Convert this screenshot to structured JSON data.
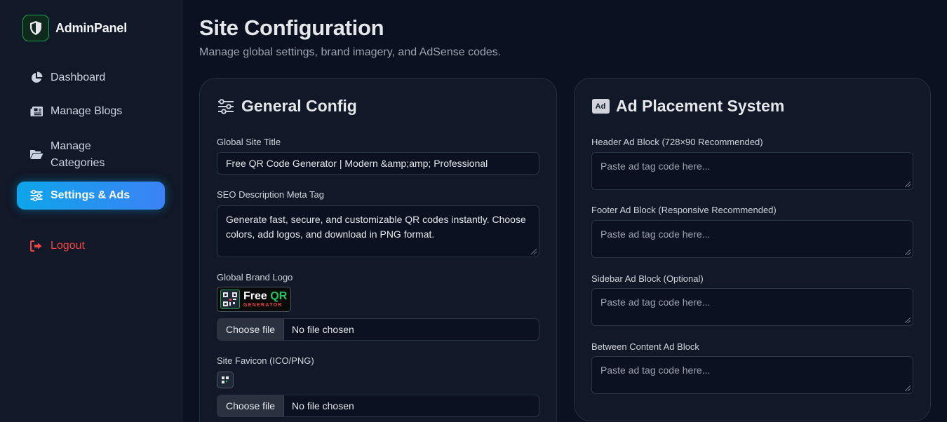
{
  "brand": {
    "name": "AdminPanel",
    "icon": "shield-icon"
  },
  "nav": {
    "items": [
      {
        "label": "Dashboard",
        "icon": "pie-chart-icon"
      },
      {
        "label": "Manage Blogs",
        "icon": "newspaper-icon"
      },
      {
        "label": "Manage Categories",
        "label_lines": [
          "Manage",
          "Categories"
        ],
        "icon": "folder-open-icon"
      },
      {
        "label": "Settings & Ads",
        "icon": "sliders-icon",
        "active": true
      }
    ],
    "logout": {
      "label": "Logout",
      "icon": "sign-out-icon"
    }
  },
  "page": {
    "title": "Site Configuration",
    "subtitle": "Manage global settings, brand imagery, and AdSense codes."
  },
  "general": {
    "title": "General Config",
    "icon": "sliders-icon",
    "site_title_label": "Global Site Title",
    "site_title_value": "Free QR Code Generator | Modern &amp;amp; Professional",
    "seo_label": "SEO Description Meta Tag",
    "seo_value": "Generate fast, secure, and customizable QR codes instantly. Choose colors, add logos, and download in PNG format.",
    "logo_label": "Global Brand Logo",
    "logo_preview": {
      "main": "Free",
      "accent": "QR",
      "sub": "GENERATOR"
    },
    "logo_file": {
      "button": "Choose file",
      "status": "No file chosen"
    },
    "favicon_label": "Site Favicon (ICO/PNG)",
    "favicon_file": {
      "button": "Choose file",
      "status": "No file chosen"
    }
  },
  "ads": {
    "title": "Ad Placement System",
    "icon": "ad-icon",
    "icon_text": "Ad",
    "placeholder": "Paste ad tag code here...",
    "blocks": [
      {
        "label": "Header Ad Block (728×90 Recommended)"
      },
      {
        "label": "Footer Ad Block (Responsive Recommended)"
      },
      {
        "label": "Sidebar Ad Block (Optional)"
      },
      {
        "label": "Between Content Ad Block"
      }
    ]
  },
  "colors": {
    "background": "#0b1120",
    "panel": "#111827",
    "accent_start": "#0ea5e9",
    "accent_end": "#3b82f6",
    "brand_green": "#22c55e",
    "logout_red": "#ef4444"
  }
}
